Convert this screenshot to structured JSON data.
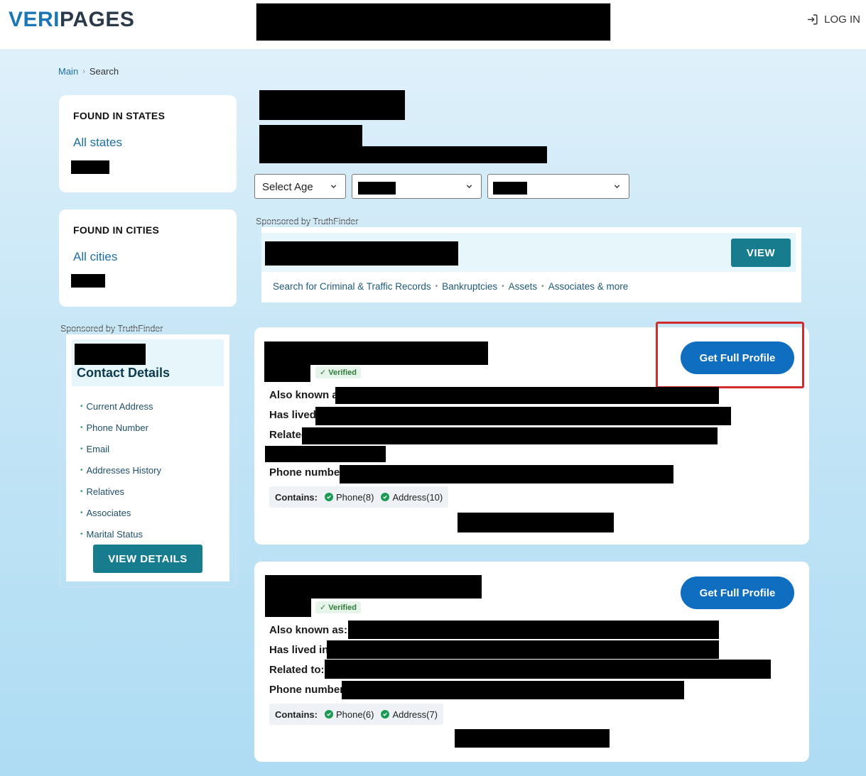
{
  "header": {
    "logo_part1": "VERI",
    "logo_part2": "PAGES",
    "login_label": "LOG IN"
  },
  "breadcrumb": {
    "main": "Main",
    "current": "Search"
  },
  "sidebar": {
    "states": {
      "title": "FOUND IN STATES",
      "link": "All states"
    },
    "cities": {
      "title": "FOUND IN CITIES",
      "link": "All cities"
    },
    "ad": {
      "sponsor": "Sponsored by TruthFinder",
      "title": "Contact Details",
      "items": [
        "Current Address",
        "Phone Number",
        "Email",
        "Addresses History",
        "Relatives",
        "Associates",
        "Marital Status"
      ],
      "button": "VIEW DETAILS"
    }
  },
  "filters": {
    "age_label": "Select Age"
  },
  "banner": {
    "sponsor": "Sponsored by TruthFinder",
    "button": "VIEW",
    "links": [
      "Search for Criminal & Traffic Records",
      "Bankruptcies",
      "Assets",
      "Associates & more"
    ]
  },
  "results": [
    {
      "verified": "Verified",
      "button": "Get Full Profile",
      "labels": [
        "Also known a",
        "Has lived",
        "Related",
        "Phone number"
      ],
      "contains_label": "Contains:",
      "chips": [
        "Phone(8)",
        "Address(10)"
      ]
    },
    {
      "verified": "Verified",
      "button": "Get Full Profile",
      "labels": [
        "Also known as:",
        "Has lived in",
        "Related to:",
        "Phone number"
      ],
      "contains_label": "Contains:",
      "chips": [
        "Phone(6)",
        "Address(7)"
      ]
    }
  ],
  "colors": {
    "brand_blue": "#1b76b7",
    "teal_button": "#177d8e",
    "profile_button": "#0f6ebf",
    "highlight": "#d12b2b"
  }
}
